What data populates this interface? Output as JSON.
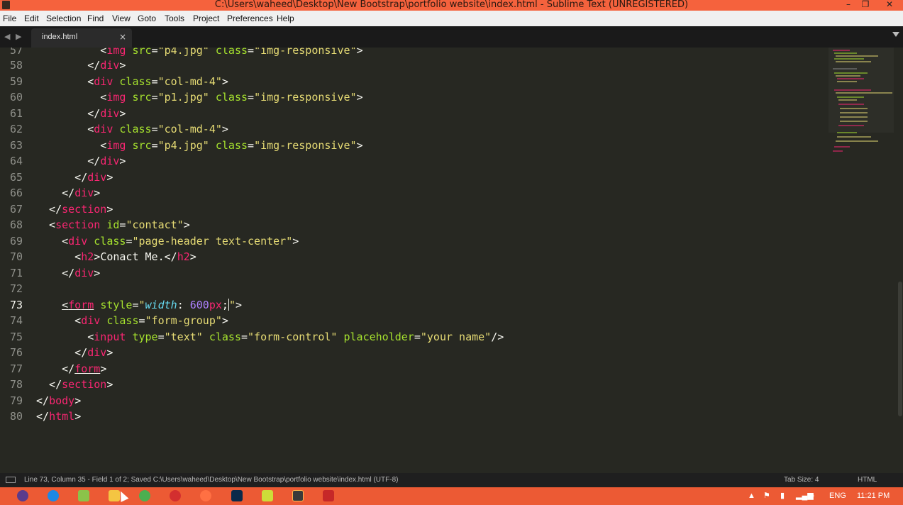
{
  "window": {
    "title": "C:\\Users\\waheed\\Desktop\\New Bootstrap\\portfolio website\\index.html - Sublime Text (UNREGISTERED)",
    "minimize": "–",
    "maximize": "❐",
    "close": "✕"
  },
  "menu": {
    "items": [
      "File",
      "Edit",
      "Selection",
      "Find",
      "View",
      "Goto",
      "Tools",
      "Project",
      "Preferences",
      "Help"
    ]
  },
  "tabs": {
    "active": "index.html",
    "close_glyph": "×",
    "nav_arrows": "◀ ▶"
  },
  "editor": {
    "current_line": 73,
    "lines": [
      {
        "n": "57"
      },
      {
        "n": "58"
      },
      {
        "n": "59"
      },
      {
        "n": "60"
      },
      {
        "n": "61"
      },
      {
        "n": "62"
      },
      {
        "n": "63"
      },
      {
        "n": "64"
      },
      {
        "n": "65"
      },
      {
        "n": "66"
      },
      {
        "n": "67"
      },
      {
        "n": "68"
      },
      {
        "n": "69"
      },
      {
        "n": "70"
      },
      {
        "n": "71"
      },
      {
        "n": "72"
      },
      {
        "n": "73"
      },
      {
        "n": "74"
      },
      {
        "n": "75"
      },
      {
        "n": "76"
      },
      {
        "n": "77"
      },
      {
        "n": "78"
      },
      {
        "n": "79"
      },
      {
        "n": "80"
      }
    ],
    "code": {
      "l57_src": "\"p4.jpg\"",
      "l57_cls": "\"img-responsive\"",
      "col_class": "\"col-md-4\"",
      "img_p1": "\"p1.jpg\"",
      "img_p4": "\"p4.jpg\"",
      "img_resp": "\"img-responsive\"",
      "section_id": "\"contact\"",
      "header_class": "\"page-header text-center\"",
      "h2_text": "Conact Me.",
      "form_prop": "width",
      "form_num": "600",
      "form_unit": "px",
      "form_group": "\"form-group\"",
      "input_type": "\"text\"",
      "input_class": "\"form-control\"",
      "input_placeholder": "\"your name\""
    }
  },
  "status": {
    "text": "Line 73, Column 35 - Field 1 of 2; Saved C:\\Users\\waheed\\Desktop\\New Bootstrap\\portfolio website\\index.html (UTF-8)",
    "tab_size": "Tab Size: 4",
    "syntax": "HTML"
  },
  "taskbar": {
    "language": "ENG",
    "time": "11:21 PM",
    "icons": [
      "start-icon",
      "ie-icon",
      "notepad-icon",
      "file-explorer-icon",
      "chrome-icon",
      "opera-icon",
      "firefox-icon",
      "photoshop-icon",
      "folder-icon",
      "sublime-icon",
      "powerpoint-icon"
    ],
    "colors": {
      "bar": "#ec5a34",
      "title": "#f5623d"
    }
  },
  "theme": {
    "tag": "#f92672",
    "attr": "#a6e22e",
    "string": "#e6db74",
    "number": "#ae81ff",
    "background": "#272822"
  }
}
